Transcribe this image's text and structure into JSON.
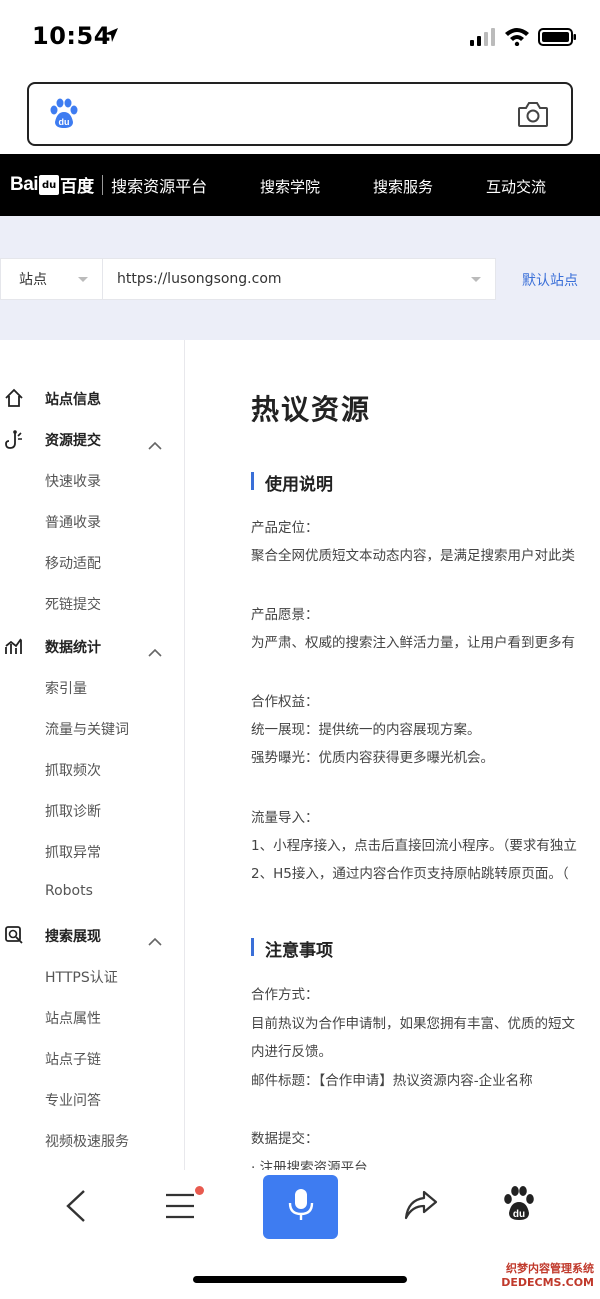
{
  "status_bar": {
    "time": "10:54"
  },
  "topnav": {
    "logo_bai": "Bai",
    "logo_du": "du",
    "logo_cn": "百度",
    "platform": "搜索资源平台",
    "links": [
      "搜索学院",
      "搜索服务",
      "互动交流"
    ]
  },
  "site_selector": {
    "kind": "站点",
    "url": "https://lusongsong.com",
    "default_link": "默认站点"
  },
  "sidebar": {
    "site_info": "站点信息",
    "resource_submit": "资源提交",
    "resource_items": [
      "快速收录",
      "普通收录",
      "移动适配",
      "死链提交"
    ],
    "data_stats": "数据统计",
    "data_items": [
      "索引量",
      "流量与关键词",
      "抓取频次",
      "抓取诊断",
      "抓取异常",
      "Robots"
    ],
    "search_display": "搜索展现",
    "display_items": [
      "HTTPS认证",
      "站点属性",
      "站点子链",
      "专业问答",
      "视频极速服务"
    ]
  },
  "main": {
    "page_title": "热议资源",
    "section1_title": "使用说明",
    "section1_lines": [
      "产品定位：",
      "聚合全网优质短文本动态内容，是满足搜索用户对此类",
      "产品愿景：",
      "为严肃、权威的搜索注入鲜活力量，让用户看到更多有",
      "合作权益：",
      "统一展现：提供统一的内容展现方案。",
      "强势曝光：优质内容获得更多曝光机会。",
      "流量导入：",
      "1、小程序接入，点击后直接回流小程序。（要求有独立",
      "2、H5接入，通过内容合作页支持原帖跳转原页面。（"
    ],
    "section2_title": "注意事项",
    "section2_lines": [
      "合作方式：",
      "目前热议为合作申请制，如果您拥有丰富、优质的短文",
      "内进行反馈。",
      "邮件标题：【合作申请】热议资源内容-企业名称",
      "数据提交：",
      "· 注册搜索资源平台"
    ]
  },
  "watermark": {
    "line1": "织梦内容管理系统",
    "line2": "DEDECMS.COM"
  },
  "colors": {
    "accent": "#3a6fd8",
    "mic_bg": "#3e7cf1",
    "band_bg": "#eceef8",
    "nav_bg": "#000000"
  }
}
